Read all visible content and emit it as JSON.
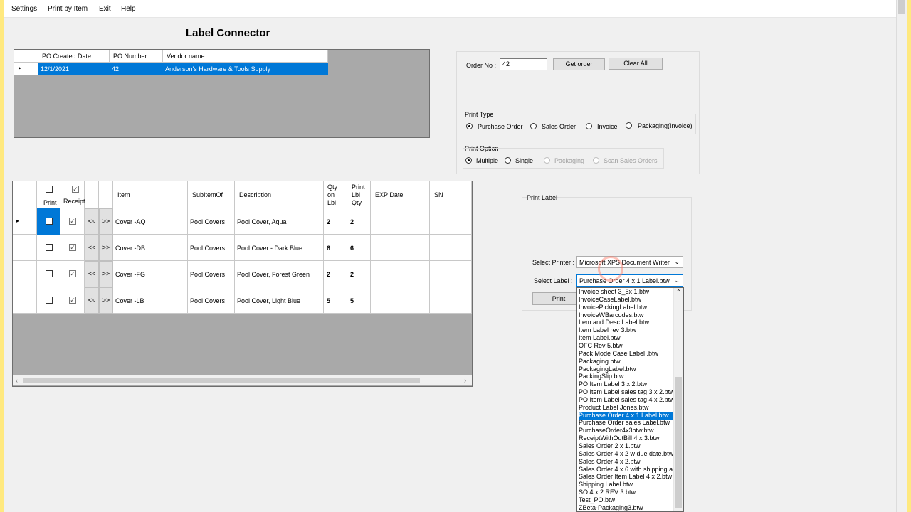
{
  "menu": [
    "Settings",
    "Print by Item",
    "Exit",
    "Help"
  ],
  "title": "Label Connector",
  "po_grid": {
    "columns": [
      "PO Created Date",
      "PO Number",
      "Vendor name"
    ],
    "row": {
      "date": "12/1/2021",
      "number": "42",
      "vendor": "Anderson's Hardware & Tools Supply"
    }
  },
  "order": {
    "label": "Order No :",
    "value": "42",
    "get_order": "Get order",
    "clear_all": "Clear All"
  },
  "print_type": {
    "label": "Print Type",
    "options": [
      "Purchase Order",
      "Sales Order",
      "Invoice",
      "Packaging(Invoice)"
    ],
    "selected": "Purchase Order"
  },
  "print_option": {
    "label": "Print Option",
    "options": [
      "Multiple",
      "Single",
      "Packaging",
      "Scan Sales Orders"
    ],
    "selected": "Multiple"
  },
  "items_grid": {
    "headers": {
      "print": "Print",
      "receipt": "Receipt",
      "item": "Item",
      "subitem": "SubItemOf",
      "description": "Description",
      "qty1": "Qty",
      "qty2": "on",
      "qty3": "Lbl",
      "plq1": "Print",
      "plq2": "Lbl",
      "plq3": "Qty",
      "exp": "EXP Date",
      "sn": "SN"
    },
    "back": "<<",
    "fwd": ">>",
    "rows": [
      {
        "item": "Cover -AQ",
        "subitem": "Pool Covers",
        "description": "Pool Cover, Aqua",
        "qty": "2",
        "print_qty": "2"
      },
      {
        "item": "Cover -DB",
        "subitem": "Pool Covers",
        "description": "Pool Cover - Dark Blue",
        "qty": "6",
        "print_qty": "6"
      },
      {
        "item": "Cover -FG",
        "subitem": "Pool Covers",
        "description": "Pool Cover, Forest Green",
        "qty": "2",
        "print_qty": "2"
      },
      {
        "item": "Cover -LB",
        "subitem": "Pool Covers",
        "description": "Pool Cover, Light Blue",
        "qty": "5",
        "print_qty": "5"
      }
    ]
  },
  "print_label": {
    "group": "Print Label",
    "printer_label": "Select Printer :",
    "printer_value": "Microsoft XPS Document Writer",
    "label_label": "Select Label :",
    "label_value": "Purchase Order 4 x 1 Label.btw",
    "print_button": "Print"
  },
  "label_list": [
    "Invoice sheet 3_5x 1.btw",
    "InvoiceCaseLabel.btw",
    "InvoicePickingLabel.btw",
    "InvoiceWBarcodes.btw",
    "Item and Desc Label.btw",
    "Item Label rev 3.btw",
    "Item Label.btw",
    "OFC Rev 5.btw",
    "Pack Mode Case Label .btw",
    "Packaging.btw",
    "PackagingLabel.btw",
    "PackingSlip.btw",
    "PO Item Label 3 x 2.btw",
    "PO Item Label sales tag 3 x 2.btw",
    "PO Item Label sales tag 4 x 2.btw",
    "Product Label Jones.btw",
    "Purchase Order 4 x 1 Label.btw",
    "Purchase Order sales Label.btw",
    "PurchaseOrder4x3btw.btw",
    "ReceiptWithOutBill 4 x 3.btw",
    "Sales Order 2 x 1.btw",
    "Sales Order 4 x 2 w due date.btw",
    "Sales Order 4 x 2.btw",
    "Sales Order 4 x 6 with shipping ad",
    "Sales Order Item Label 4 x 2.btw",
    "Shipping Label.btw",
    "SO  4 x 2 REV 3.btw",
    "Test_PO.btw",
    "ZBeta-Packaging3.btw"
  ],
  "label_list_selected": "Purchase Order 4 x 1 Label.btw",
  "colors": {
    "selection": "#0078d7",
    "accent_bar": "#ffe97f",
    "panel": "#a9a9a9"
  }
}
